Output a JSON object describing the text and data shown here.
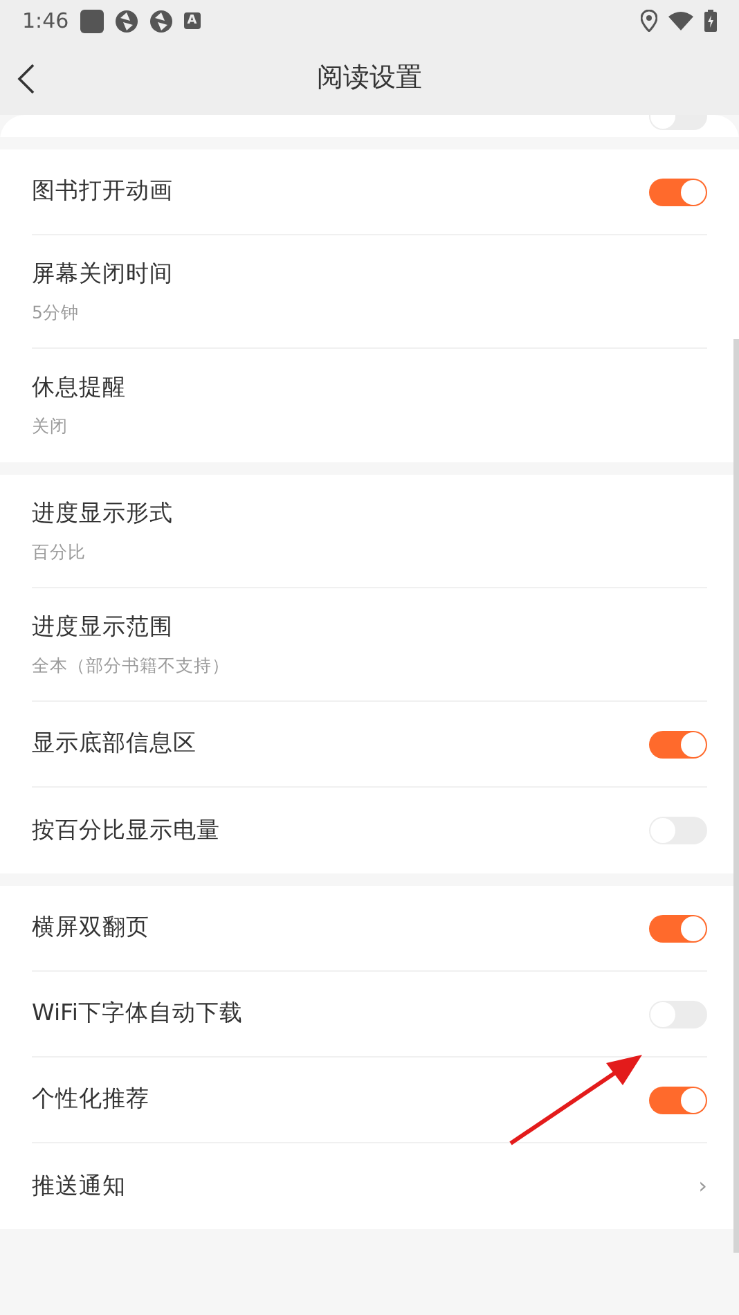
{
  "status_bar": {
    "time": "1:46",
    "notification_badge": "A"
  },
  "header": {
    "title": "阅读设置"
  },
  "sections": [
    {
      "rows": [
        {
          "kind": "toggle",
          "on": false
        }
      ]
    },
    {
      "rows": [
        {
          "kind": "toggle",
          "title": "图书打开动画",
          "on": true
        },
        {
          "kind": "value",
          "title": "屏幕关闭时间",
          "value": "5分钟"
        },
        {
          "kind": "value",
          "title": "休息提醒",
          "value": "关闭"
        }
      ]
    },
    {
      "rows": [
        {
          "kind": "value",
          "title": "进度显示形式",
          "value": "百分比"
        },
        {
          "kind": "value",
          "title": "进度显示范围",
          "value": "全本（部分书籍不支持）"
        },
        {
          "kind": "toggle",
          "title": "显示底部信息区",
          "on": true
        },
        {
          "kind": "toggle",
          "title": "按百分比显示电量",
          "on": false
        }
      ]
    },
    {
      "rows": [
        {
          "kind": "toggle",
          "title": "横屏双翻页",
          "on": true
        },
        {
          "kind": "toggle",
          "title": "WiFi下字体自动下载",
          "on": false
        },
        {
          "kind": "toggle",
          "title": "个性化推荐",
          "on": true
        },
        {
          "kind": "link",
          "title": "推送通知",
          "chevron": "›"
        }
      ]
    }
  ],
  "annotation": {
    "kind": "arrow"
  }
}
